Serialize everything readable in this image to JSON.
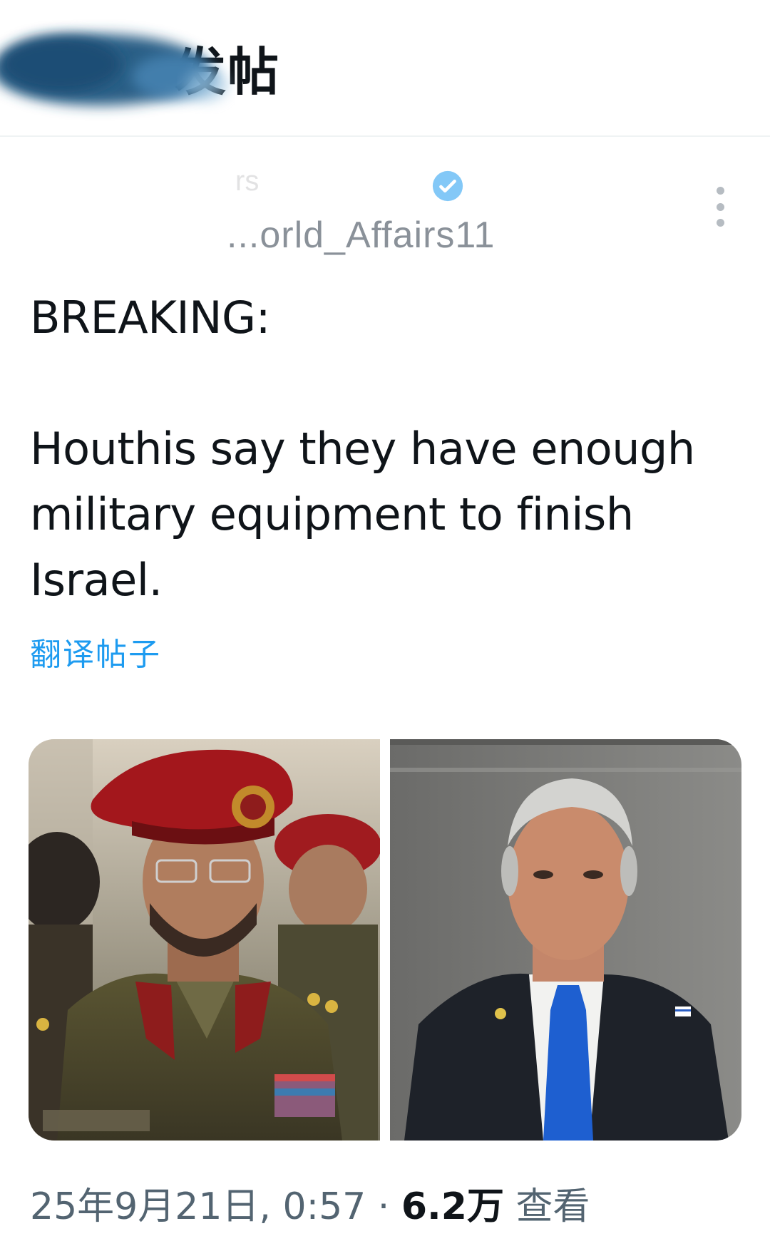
{
  "header": {
    "title": "发帖",
    "back_icon": "arrow-left-icon"
  },
  "author": {
    "display_name": "rs",
    "handle": "...orld_Affairs11",
    "verified_icon": "verified-badge-icon",
    "more_icon": "more-vertical-icon",
    "avatar_obscured": true
  },
  "post": {
    "paragraphs": [
      "BREAKING:",
      "Houthis say they have enough military equipment to finish Israel."
    ],
    "translate_label": "翻译帖子",
    "images": [
      {
        "name": "military-officer-photo"
      },
      {
        "name": "politician-photo"
      }
    ]
  },
  "meta": {
    "timestamp": "25年9月21日, 0:57",
    "separator": "·",
    "views_count": "6.2万",
    "views_label": "查看"
  },
  "colors": {
    "accent": "#1d9bf0",
    "text": "#0f1419",
    "secondary": "#536471"
  }
}
